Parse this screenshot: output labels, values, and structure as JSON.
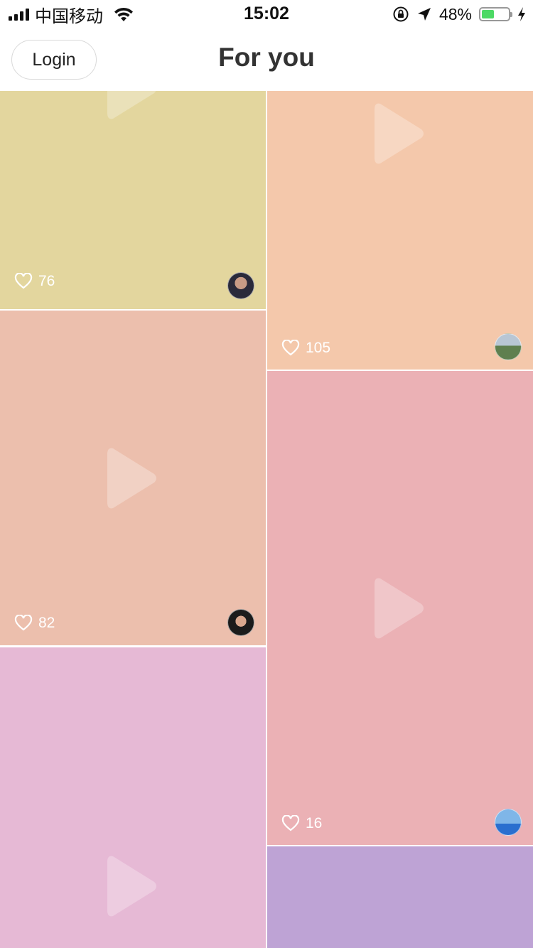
{
  "status_bar": {
    "carrier": "中国移动",
    "time": "15:02",
    "battery_percent": "48%",
    "battery_level": 0.48,
    "icons": [
      "signal-icon",
      "wifi-icon",
      "rotation-lock-icon",
      "location-arrow-icon",
      "battery-icon",
      "charging-bolt-icon"
    ]
  },
  "header": {
    "login_label": "Login",
    "title": "For you"
  },
  "feed": {
    "left_column": [
      {
        "likes": "76",
        "color": "#e3d69e"
      },
      {
        "likes": "82",
        "color": "#ecbfad"
      },
      {
        "likes": "",
        "color": "#e6b9d5"
      }
    ],
    "right_column": [
      {
        "likes": "105",
        "color": "#f4c8ab"
      },
      {
        "likes": "16",
        "color": "#ebb1b5"
      },
      {
        "likes": "",
        "color": "#bea3d5"
      }
    ]
  },
  "colors": {
    "accent_battery": "#4cd964",
    "text_dark": "#333333"
  }
}
